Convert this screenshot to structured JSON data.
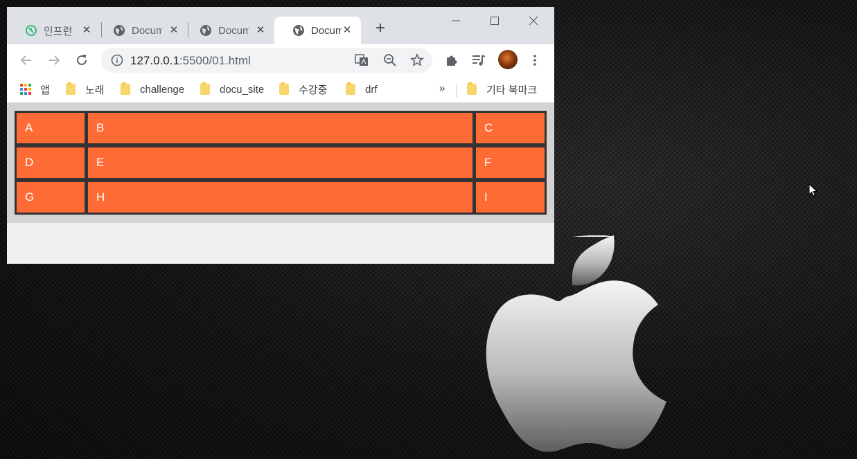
{
  "browser": {
    "tabs": [
      {
        "title": "인프런",
        "icon": "inflearn-icon",
        "active": false
      },
      {
        "title": "Document",
        "icon": "globe-icon",
        "active": false
      },
      {
        "title": "Document",
        "icon": "globe-icon",
        "active": false
      },
      {
        "title": "Document",
        "icon": "globe-icon",
        "active": true
      }
    ],
    "new_tab_label": "+",
    "url_host": "127.0.0.1",
    "url_rest": ":5500/01.html",
    "bookmarks": {
      "apps_label": "앱",
      "items": [
        "노래",
        "challenge",
        "docu_site",
        "수강중",
        "drf"
      ],
      "more_label": "»",
      "other_label": "기타 북마크"
    }
  },
  "page": {
    "cells": [
      "A",
      "B",
      "C",
      "D",
      "E",
      "F",
      "G",
      "H",
      "I"
    ],
    "colors": {
      "cell": "#ff6b35",
      "grid_border": "#333333",
      "container": "#d3d3d3"
    }
  },
  "desktop": {
    "logo": "apple-logo",
    "cursor": "mouse-pointer"
  }
}
